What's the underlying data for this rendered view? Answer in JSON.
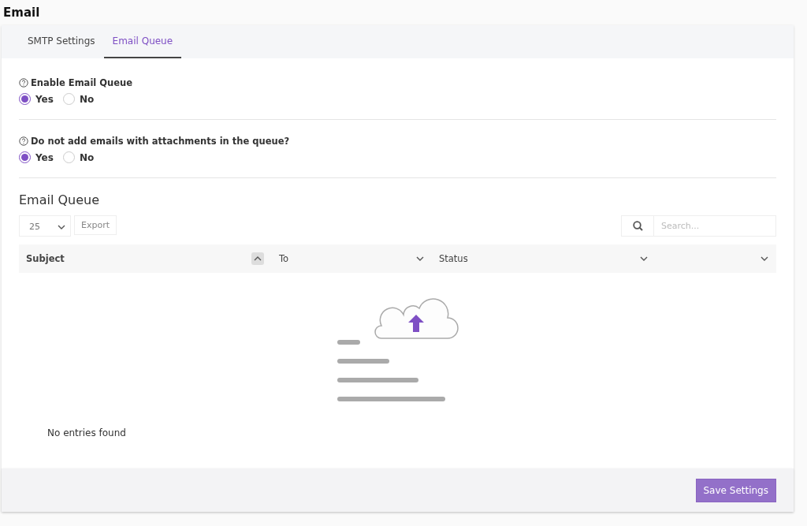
{
  "page_title": "Email",
  "tabs": [
    {
      "label": "SMTP Settings",
      "selected": false
    },
    {
      "label": "Email Queue",
      "selected": true
    }
  ],
  "settings": [
    {
      "label": "Enable Email Queue",
      "options": [
        {
          "label": "Yes",
          "selected": true
        },
        {
          "label": "No",
          "selected": false
        }
      ]
    },
    {
      "label": "Do not add emails with attachments in the queue?",
      "options": [
        {
          "label": "Yes",
          "selected": true
        },
        {
          "label": "No",
          "selected": false
        }
      ]
    }
  ],
  "queue": {
    "title": "Email Queue",
    "page_size": "25",
    "export_label": "Export",
    "search": {
      "placeholder": "Search..."
    },
    "columns": [
      {
        "label": "Subject",
        "sorted": true
      },
      {
        "label": "To",
        "sorted": false
      },
      {
        "label": "Status",
        "sorted": false
      },
      {
        "sorted": false
      }
    ],
    "empty_message": "No entries found"
  },
  "save_button": "Save Settings"
}
